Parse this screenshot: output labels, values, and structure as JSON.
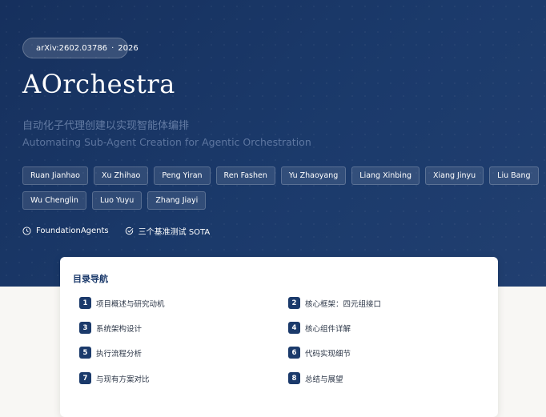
{
  "badge": {
    "arxiv": "arXiv:2602.03786",
    "separator": "·",
    "year": "2026"
  },
  "title": "AOrchestra",
  "subtitle_cn": "自动化子代理创建以实现智能体编排",
  "subtitle_en": "Automating Sub-Agent Creation for Agentic Orchestration",
  "authors": [
    "Ruan Jianhao",
    "Xu Zhihao",
    "Peng Yiran",
    "Ren Fashen",
    "Yu Zhaoyang",
    "Liang Xinbing",
    "Xiang Jinyu",
    "Liu Bang",
    "Wu Chenglin",
    "Luo Yuyu",
    "Zhang Jiayi"
  ],
  "meta": {
    "org": "FoundationAgents",
    "benchmark": "三个基准测试 SOTA"
  },
  "toc": {
    "title": "目录导航",
    "items": [
      {
        "num": "1",
        "label": "项目概述与研究动机"
      },
      {
        "num": "2",
        "label": "核心框架：四元组接口"
      },
      {
        "num": "3",
        "label": "系统架构设计"
      },
      {
        "num": "4",
        "label": "核心组件详解"
      },
      {
        "num": "5",
        "label": "执行流程分析"
      },
      {
        "num": "6",
        "label": "代码实现细节"
      },
      {
        "num": "7",
        "label": "与现有方案对比"
      },
      {
        "num": "8",
        "label": "总结与展望"
      }
    ]
  }
}
